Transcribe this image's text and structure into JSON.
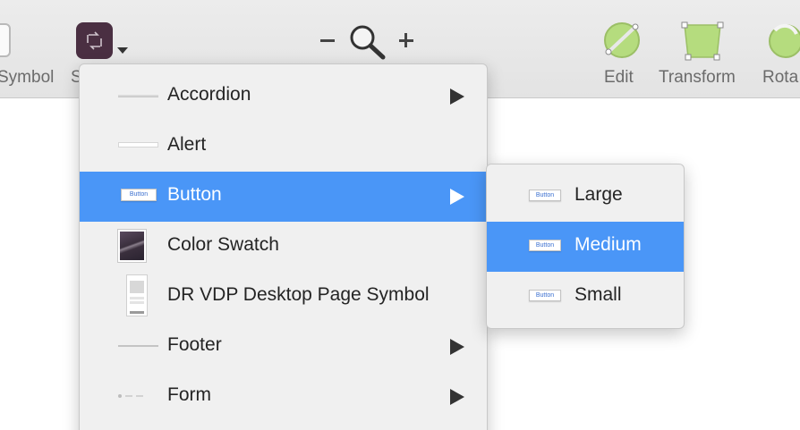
{
  "toolbar": {
    "symbol_label": "Symbol",
    "symbols_label": "S",
    "edit_label": "Edit",
    "transform_label": "Transform",
    "rotate_label": "Rota",
    "icons": [
      "symbol-icon",
      "symbols-icon",
      "dropdown-arrow-icon",
      "zoom-out-icon",
      "magnifier-icon",
      "zoom-in-icon",
      "edit-icon",
      "transform-icon",
      "rotate-icon"
    ]
  },
  "menu": {
    "items": [
      {
        "label": "Accordion",
        "submenu": true,
        "thumb": "line"
      },
      {
        "label": "Alert",
        "submenu": false,
        "thumb": "line-text"
      },
      {
        "label": "Button",
        "submenu": true,
        "thumb": "button",
        "selected": true
      },
      {
        "label": "Color Swatch",
        "submenu": false,
        "thumb": "swatch"
      },
      {
        "label": "DR VDP Desktop Page Symbol",
        "submenu": false,
        "thumb": "page"
      },
      {
        "label": "Footer",
        "submenu": true,
        "thumb": "line"
      },
      {
        "label": "Form",
        "submenu": true,
        "thumb": "dots"
      }
    ]
  },
  "submenu": {
    "thumb_text": "Button",
    "items": [
      {
        "label": "Large"
      },
      {
        "label": "Medium",
        "selected": true
      },
      {
        "label": "Small"
      }
    ]
  },
  "colors": {
    "selection": "#4a96f7",
    "menu_bg": "#f0f0f0",
    "toolbar_bg": "#e6e6e6",
    "symbols_icon_bg": "#4a2f42",
    "edit_icon_green": "#b5dc7e"
  }
}
